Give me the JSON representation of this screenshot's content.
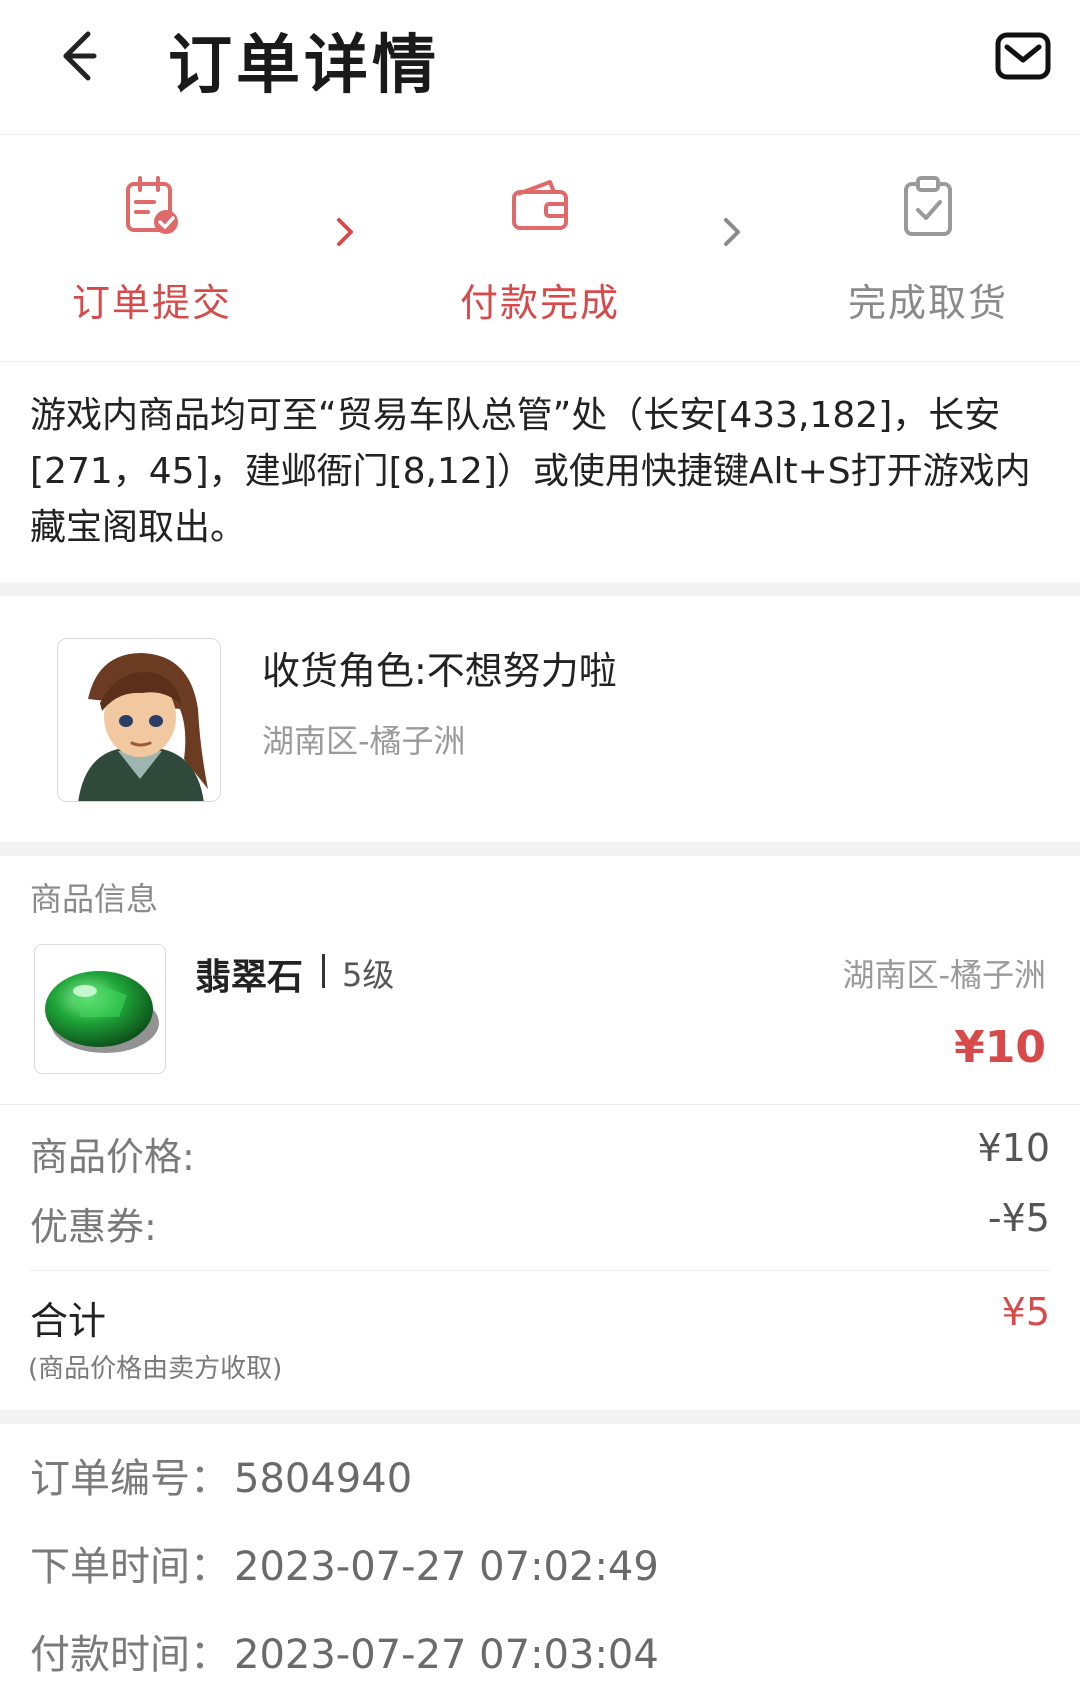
{
  "header": {
    "title": "订单详情"
  },
  "steps": [
    {
      "label": "订单提交"
    },
    {
      "label": "付款完成"
    },
    {
      "label": "完成取货"
    }
  ],
  "notice": "游戏内商品均可至“贸易车队总管”处（长安[433,182]，长安[271，45]，建邺衙门[8,12]）或使用快捷键Alt+S打开游戏内藏宝阁取出。",
  "role": {
    "name": "收货角色:不想努力啦",
    "server": "湖南区-橘子洲"
  },
  "goods": {
    "section_title": "商品信息",
    "name": "翡翠石",
    "level": "5级",
    "server": "湖南区-橘子洲",
    "price": "¥10"
  },
  "pricing": {
    "price_label": "商品价格:",
    "price_value": "¥10",
    "coupon_label": "优惠券:",
    "coupon_value": "-¥5",
    "total_label": "合计",
    "total_value": "¥5",
    "total_note": "(商品价格由卖方收取)"
  },
  "order_info": {
    "number_label": "订单编号：",
    "number_value": "5804940",
    "created_label": "下单时间：",
    "created_value": "2023-07-27 07:02:49",
    "paid_label": "付款时间：",
    "paid_value": "2023-07-27 07:03:04"
  },
  "colors": {
    "accent": "#d84a4a",
    "inactive": "#8a8a8a"
  }
}
